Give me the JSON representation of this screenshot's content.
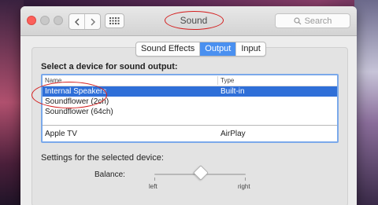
{
  "window": {
    "title": "Sound"
  },
  "search": {
    "placeholder": "Search"
  },
  "tabs": [
    {
      "label": "Sound Effects",
      "active": false
    },
    {
      "label": "Output",
      "active": true
    },
    {
      "label": "Input",
      "active": false
    }
  ],
  "output": {
    "heading": "Select a device for sound output:",
    "columns": {
      "name": "Name",
      "type": "Type"
    },
    "devices": [
      {
        "name": "Internal Speakers",
        "type": "Built-in",
        "selected": true
      },
      {
        "name": "Soundflower (2ch)",
        "type": ""
      },
      {
        "name": "Soundflower (64ch)",
        "type": ""
      },
      {
        "name": "Apple TV",
        "type": "AirPlay"
      }
    ],
    "settings_label": "Settings for the selected device:",
    "balance_label": "Balance:",
    "balance_left": "left",
    "balance_right": "right",
    "balance_value": 0.5
  },
  "colors": {
    "accent": "#2f6fd8",
    "annotation": "#d41d1d",
    "close": "#fc605b"
  },
  "icons": [
    "back-icon",
    "forward-icon",
    "grid-icon",
    "search-icon"
  ]
}
